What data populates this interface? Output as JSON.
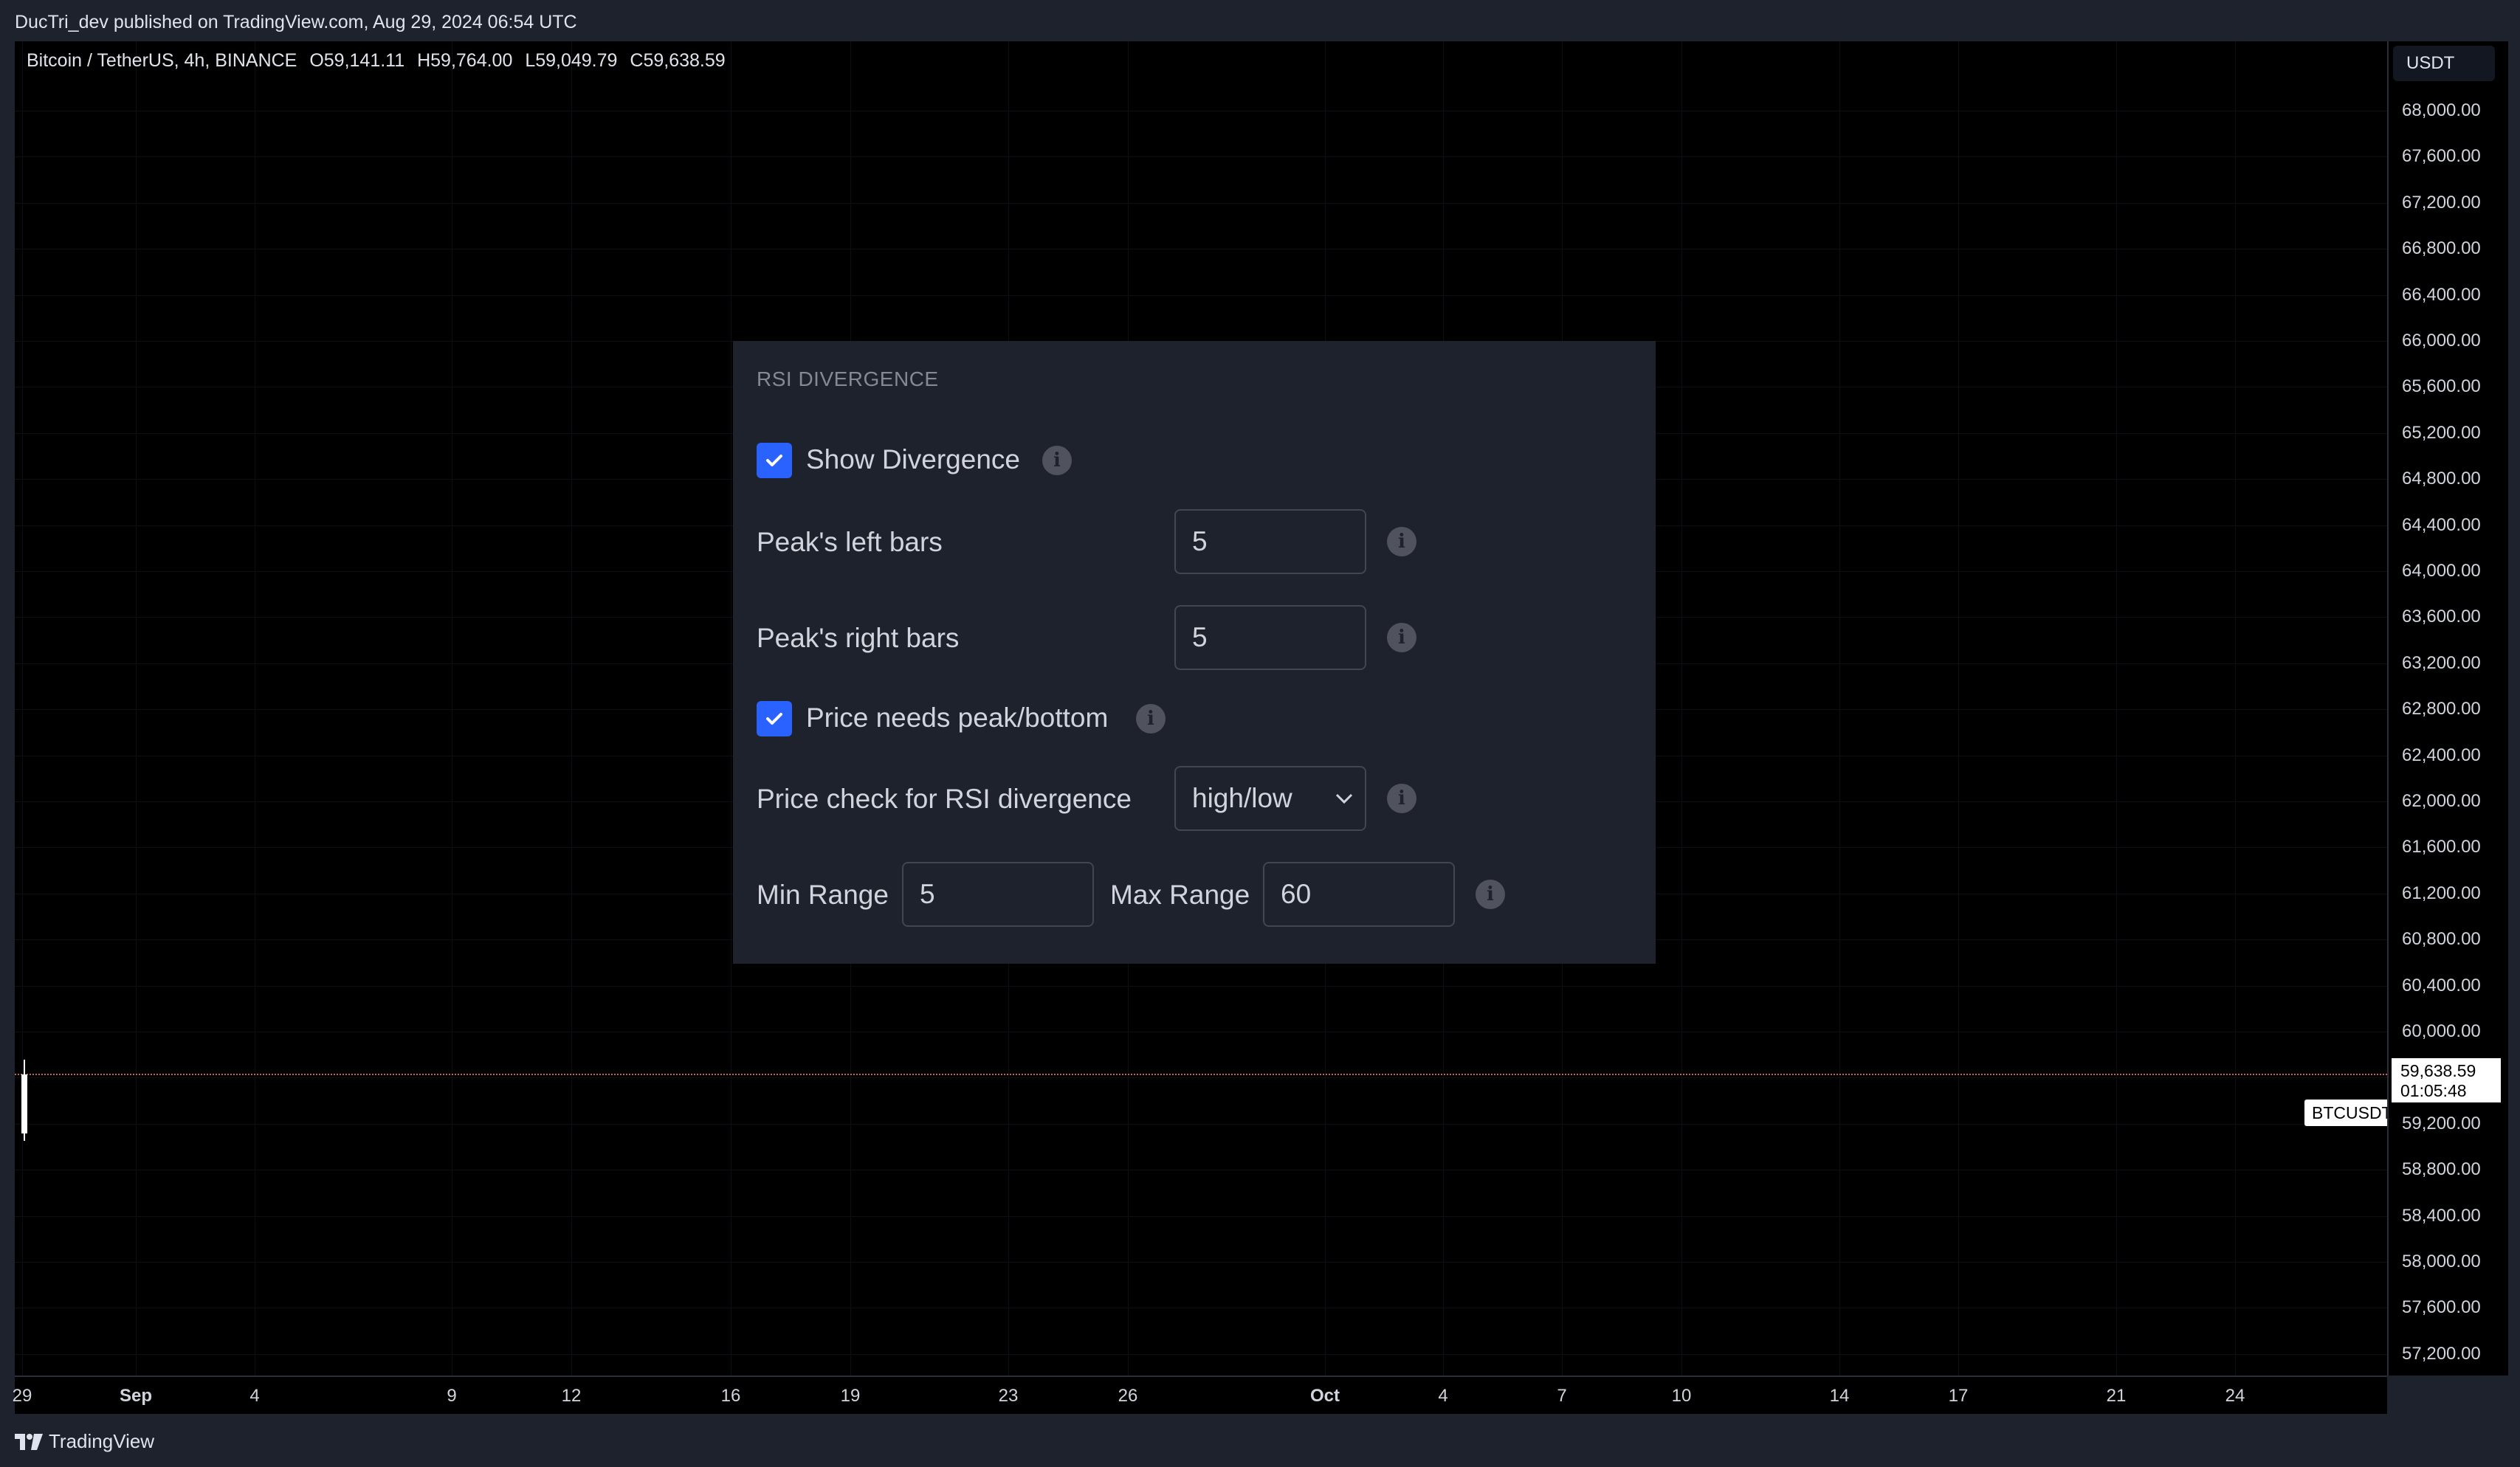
{
  "header": {
    "published_text": "DucTri_dev published on TradingView.com, Aug 29, 2024 06:54 UTC"
  },
  "chart": {
    "ohlc": {
      "symbol_text": "Bitcoin / TetherUS, 4h, BINANCE",
      "open": "O59,141.11",
      "high": "H59,764.00",
      "low": "L59,049.79",
      "close": "C59,638.59"
    },
    "currency": "USDT",
    "price_ticks": [
      "68,000.00",
      "67,600.00",
      "67,200.00",
      "66,800.00",
      "66,400.00",
      "66,000.00",
      "65,600.00",
      "65,200.00",
      "64,800.00",
      "64,400.00",
      "64,000.00",
      "63,600.00",
      "63,200.00",
      "62,800.00",
      "62,400.00",
      "62,000.00",
      "61,600.00",
      "61,200.00",
      "60,800.00",
      "60,400.00",
      "60,000.00",
      "59,200.00",
      "58,800.00",
      "58,400.00",
      "58,000.00",
      "57,600.00",
      "57,200.00"
    ],
    "time_ticks": [
      {
        "label": "29",
        "bold": false
      },
      {
        "label": "Sep",
        "bold": true
      },
      {
        "label": "4",
        "bold": false
      },
      {
        "label": "9",
        "bold": false
      },
      {
        "label": "12",
        "bold": false
      },
      {
        "label": "16",
        "bold": false
      },
      {
        "label": "19",
        "bold": false
      },
      {
        "label": "23",
        "bold": false
      },
      {
        "label": "26",
        "bold": false
      },
      {
        "label": "Oct",
        "bold": true
      },
      {
        "label": "4",
        "bold": false
      },
      {
        "label": "7",
        "bold": false
      },
      {
        "label": "10",
        "bold": false
      },
      {
        "label": "14",
        "bold": false
      },
      {
        "label": "17",
        "bold": false
      },
      {
        "label": "21",
        "bold": false
      },
      {
        "label": "24",
        "bold": false
      }
    ],
    "symbol_tag": "BTCUSDT",
    "last_price": "59,638.59",
    "countdown": "01:05:48",
    "price_line_color": "#c0635a"
  },
  "panel": {
    "title": "RSI DIVERGENCE",
    "show_divergence": {
      "label": "Show Divergence",
      "checked": true
    },
    "peak_left": {
      "label": "Peak's left bars",
      "value": "5"
    },
    "peak_right": {
      "label": "Peak's right bars",
      "value": "5"
    },
    "price_needs_peak": {
      "label": "Price needs peak/bottom",
      "checked": true
    },
    "price_check": {
      "label": "Price check for RSI divergence",
      "value": "high/low"
    },
    "min_range": {
      "label": "Min Range",
      "value": "5"
    },
    "max_range": {
      "label": "Max Range",
      "value": "60"
    },
    "info_icon": "info-icon",
    "accent_color": "#2962ff"
  },
  "footer": {
    "brand": "TradingView"
  }
}
